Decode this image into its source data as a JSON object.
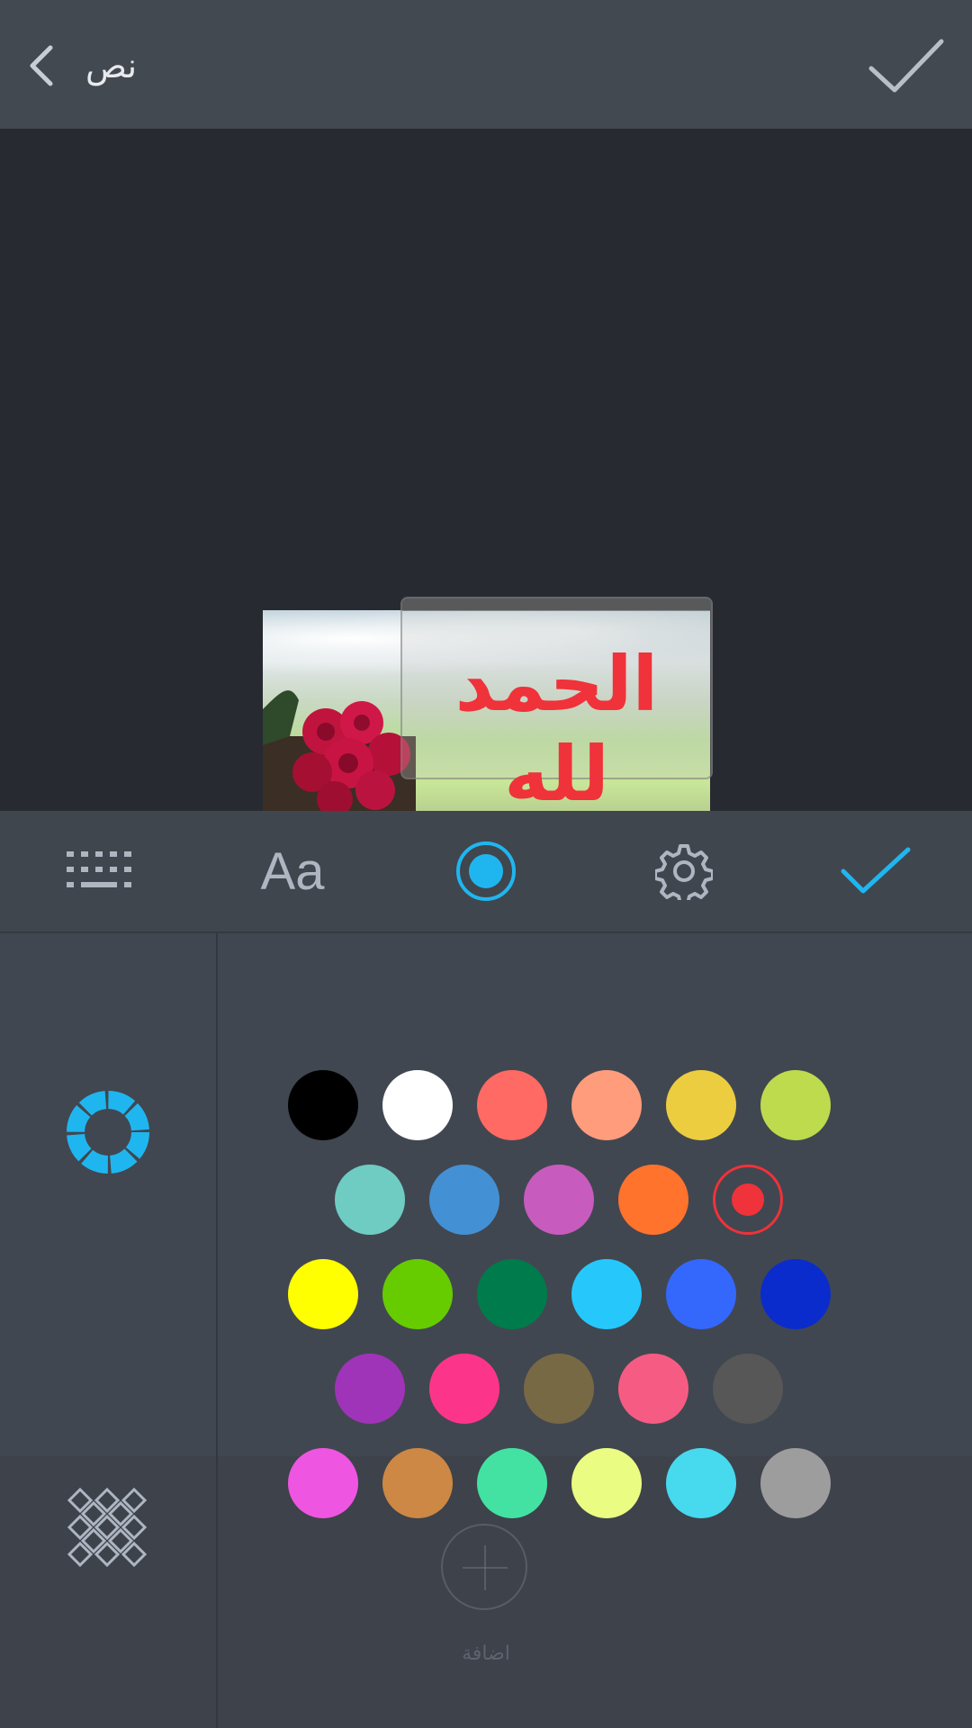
{
  "header": {
    "title": "نص"
  },
  "canvas": {
    "overlay_text": "الحمد لله",
    "overlay_text_color": "#f0323a"
  },
  "toolbar": {
    "accent": "#1fb6f0",
    "icons": [
      "keyboard-icon",
      "font-icon",
      "color-icon",
      "settings-icon",
      "check-icon"
    ],
    "font_label": "Aa"
  },
  "panel": {
    "add_label": "اضافة",
    "selected_color": "#f0323a",
    "colors": [
      [
        "#000000",
        "#ffffff",
        "#ff6a64",
        "#ff9c7c",
        "#eccd40",
        "#bedb4e"
      ],
      [
        "#6fccc2",
        "#4490d4",
        "#c85bbe",
        "#ff732d",
        "#f0323a"
      ],
      [
        "#ffff00",
        "#66cc00",
        "#007b4c",
        "#26c8fc",
        "#3468fc",
        "#0b2ccc"
      ],
      [
        "#9f34b8",
        "#fc358b",
        "#786945",
        "#f65c83",
        "#575757"
      ],
      [
        "#ee55e0",
        "#cc8844",
        "#43e2a3",
        "#ebfc83",
        "#47d9ee",
        "#9d9d9d"
      ]
    ]
  }
}
